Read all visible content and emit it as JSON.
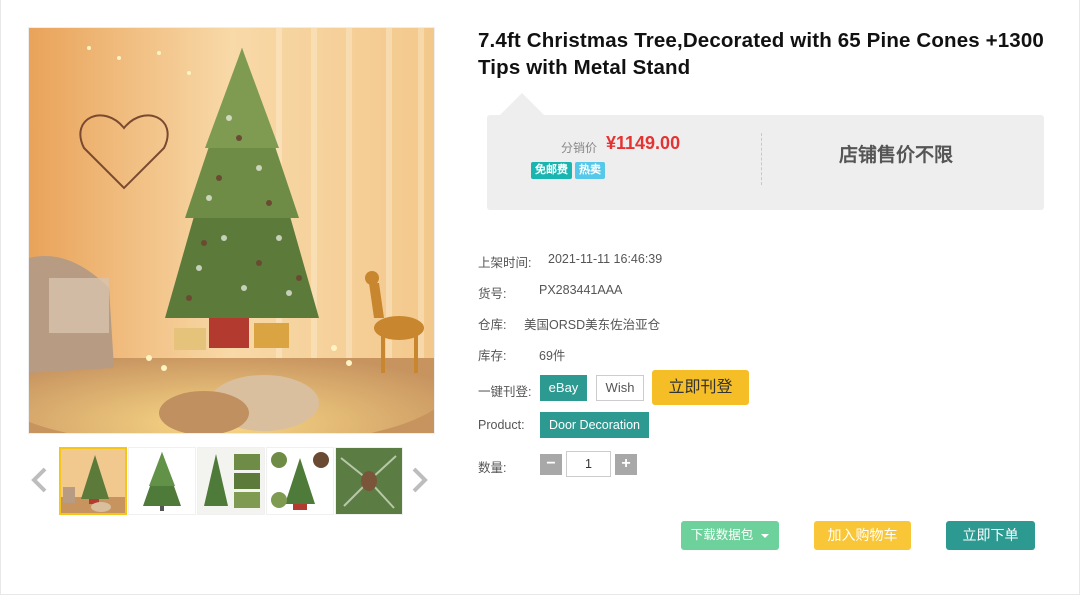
{
  "product": {
    "title": "7.4ft Christmas Tree,Decorated with 65 Pine Cones +1300 Tips with Metal Stand"
  },
  "gallery": {
    "main_image": "christmas-tree-living-room-photo",
    "thumbnails": [
      {
        "name": "thumb-tree-room",
        "active": true
      },
      {
        "name": "thumb-tree-white-bg",
        "active": false
      },
      {
        "name": "thumb-tree-details",
        "active": false
      },
      {
        "name": "thumb-tree-features",
        "active": false
      },
      {
        "name": "thumb-pine-cone-closeup",
        "active": false
      }
    ]
  },
  "pricing": {
    "label": "分销价",
    "value": "¥1149.00",
    "badges": [
      "免邮费",
      "热卖"
    ],
    "store_price_note": "店铺售价不限"
  },
  "details": [
    {
      "label": "上架时间:",
      "value": "2021-11-11 16:46:39"
    },
    {
      "label": "货号:",
      "value": "PX283441AAA"
    },
    {
      "label": "仓库:",
      "value": "美国ORSD美东佐治亚仓"
    },
    {
      "label": "库存:",
      "value": "69件"
    }
  ],
  "publish": {
    "label": "一键刊登:",
    "platforms": [
      "eBay",
      "Wish"
    ],
    "publish_button": "立即刊登"
  },
  "product_type": {
    "label": "Product:",
    "value": "Door Decoration"
  },
  "quantity": {
    "label": "数量:",
    "minus": "−",
    "value": "1",
    "plus": "+"
  },
  "actions": {
    "download": "下载数据包",
    "add_to_cart": "加入购物车",
    "buy_now": "立即下单"
  },
  "colors": {
    "price_red": "#e53333",
    "teal": "#2d9a92",
    "yellow": "#f5bd26",
    "green": "#6cd19a"
  }
}
